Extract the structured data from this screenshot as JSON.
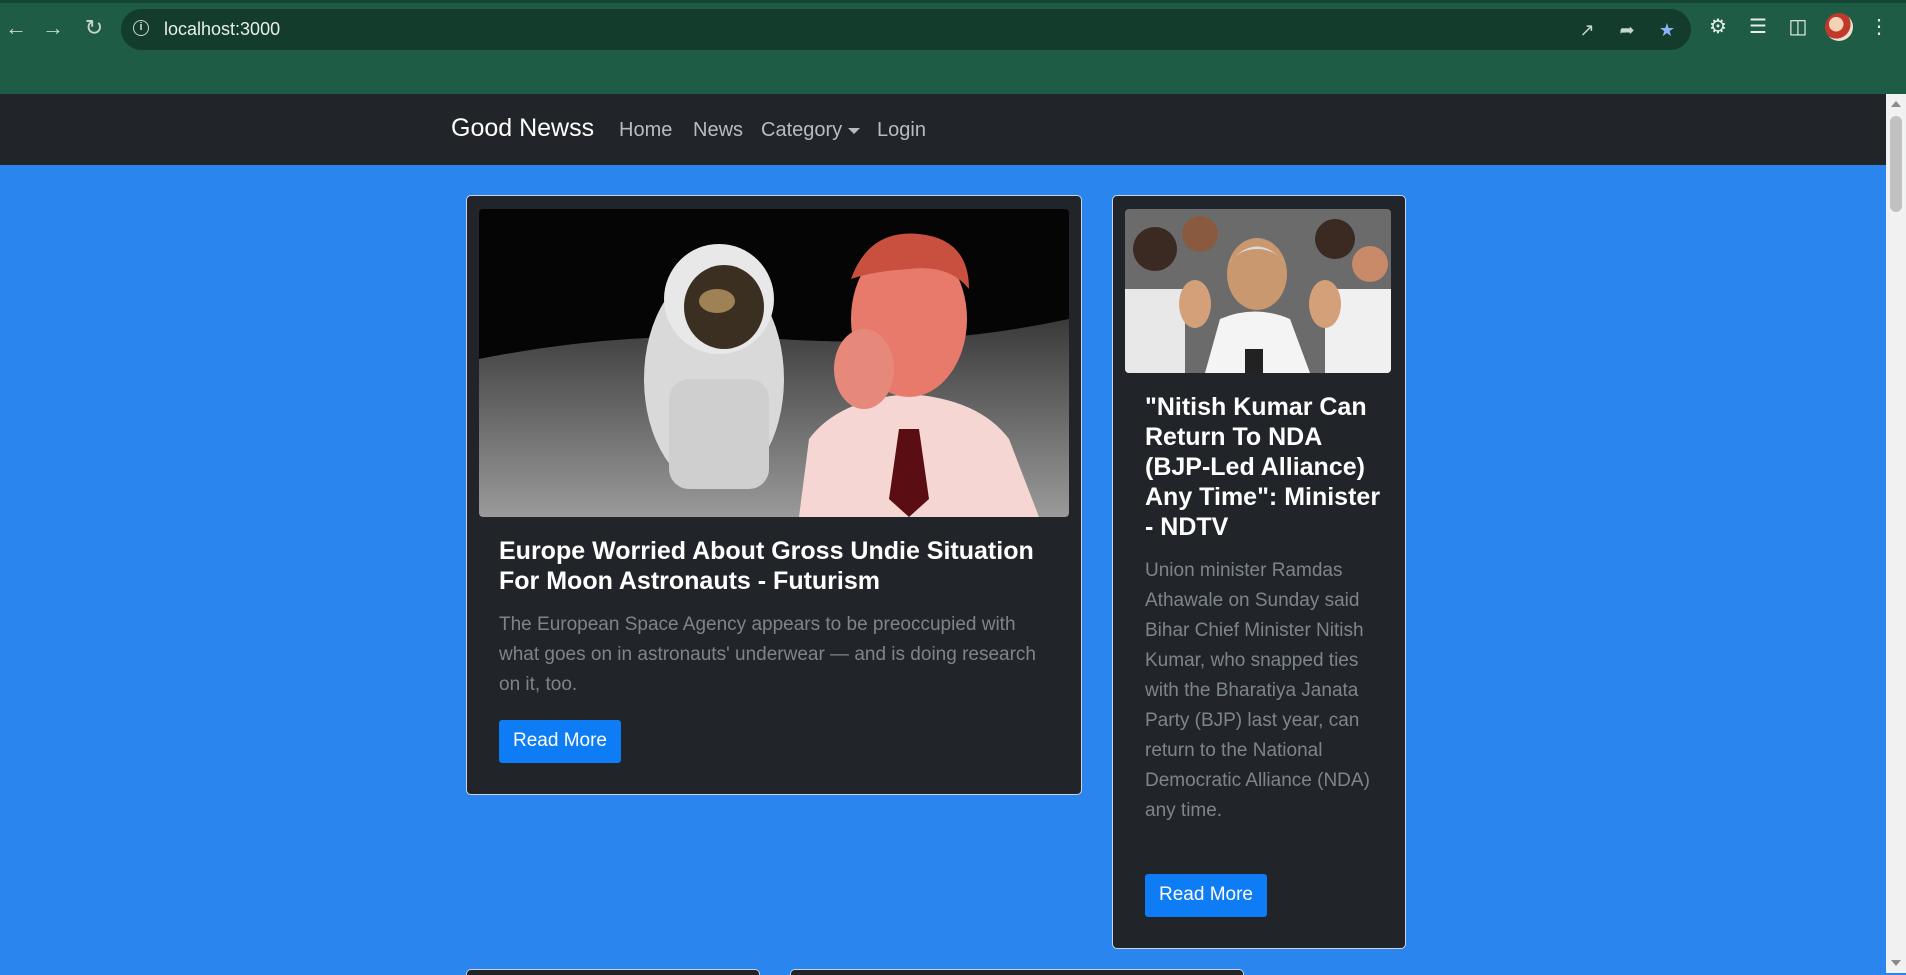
{
  "browser": {
    "url": "localhost:3000"
  },
  "navbar": {
    "brand": "Good Newss",
    "links": [
      "Home",
      "News",
      "Category",
      "Login"
    ]
  },
  "cards": [
    {
      "title": "Europe Worried About Gross Undie Situation For Moon Astronauts - Futurism",
      "description": "The European Space Agency appears to be preoccupied with what goes on in astronauts' underwear — and is doing research on it, too.",
      "button": "Read More",
      "image": "astronaut-and-man-holding-nose"
    },
    {
      "title": "\"Nitish Kumar Can Return To NDA (BJP-Led Alliance) Any Time\": Minister - NDTV",
      "description": "Union minister Ramdas Athawale on Sunday said Bihar Chief Minister Nitish Kumar, who snapped ties with the Bharatiya Janata Party (BJP) last year, can return to the National Democratic Alliance (NDA) any time.",
      "button": "Read More",
      "image": "man-waving-in-crowd"
    }
  ],
  "colors": {
    "page_bg": "#2a86ee",
    "browser_frame": "#1e5c45",
    "navbar_bg": "#212529",
    "card_bg": "#212529",
    "button_bg": "#0d7cf5"
  }
}
